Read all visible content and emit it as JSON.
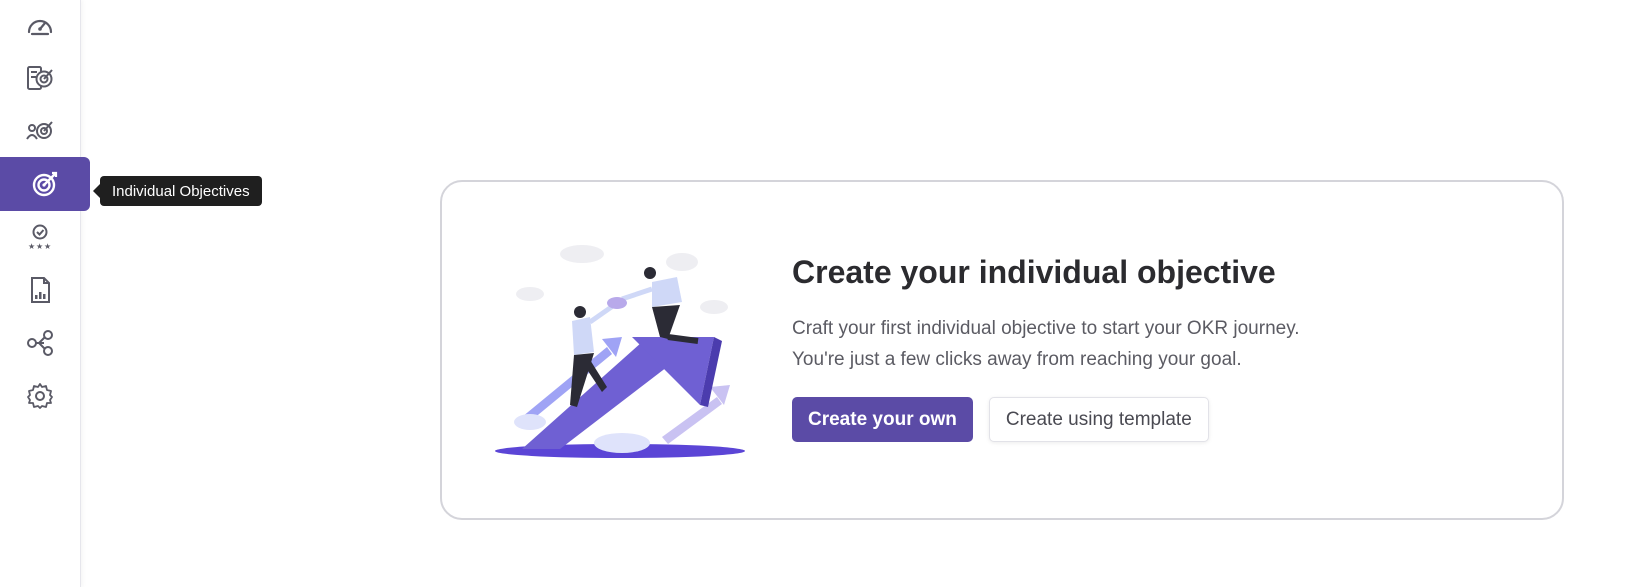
{
  "sidebar": {
    "items": [
      {
        "icon": "dashboard-gauge-icon"
      },
      {
        "icon": "company-objectives-icon"
      },
      {
        "icon": "team-objectives-icon"
      },
      {
        "icon": "individual-objectives-icon",
        "active": true
      },
      {
        "icon": "achievements-icon"
      },
      {
        "icon": "reports-icon"
      },
      {
        "icon": "alignment-network-icon"
      },
      {
        "icon": "settings-gear-icon"
      }
    ],
    "tooltip": "Individual Objectives",
    "active_color": "#5b4ba6"
  },
  "empty_state": {
    "title": "Create your individual objective",
    "description_line1": "Craft your first individual objective to start your OKR journey.",
    "description_line2": "You're just a few clicks away from reaching your goal.",
    "primary_button": "Create your own",
    "secondary_button": "Create using template",
    "illustration": "people-climbing-arrow-illustration"
  }
}
